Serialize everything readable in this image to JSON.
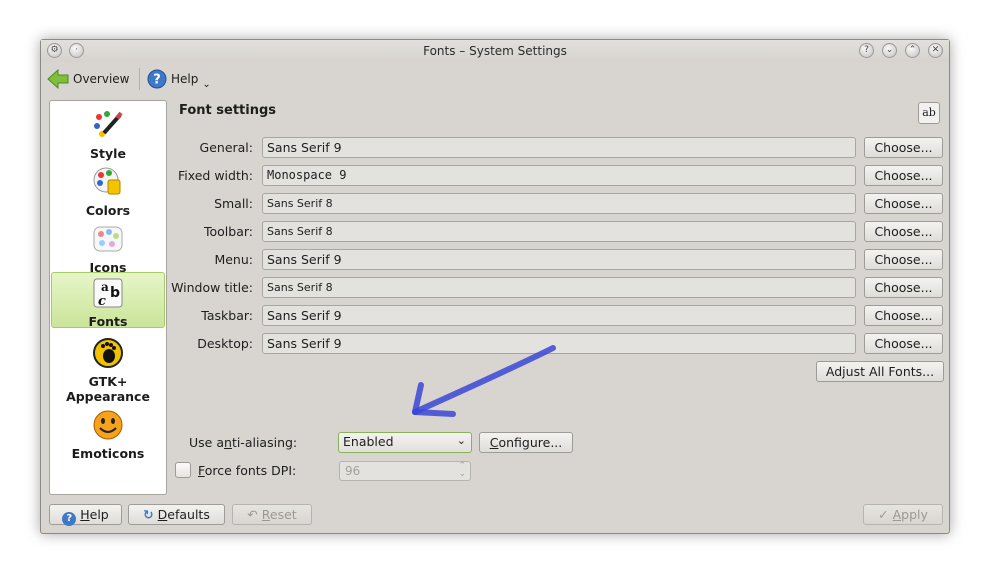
{
  "window": {
    "title": "Fonts – System Settings"
  },
  "toolbar": {
    "overview_label": "Overview",
    "help_label": "Help"
  },
  "sidebar": {
    "items": [
      {
        "label": "Style",
        "icon": "style-brush-icon"
      },
      {
        "label": "Colors",
        "icon": "colors-palette-icon"
      },
      {
        "label": "Icons",
        "icon": "icons-palette-icon"
      },
      {
        "label": "Fonts",
        "icon": "fonts-icon"
      },
      {
        "label": "GTK+\nAppearance",
        "label_line1": "GTK+",
        "label_line2": "Appearance",
        "icon": "gnome-foot-icon"
      },
      {
        "label": "Emoticons",
        "icon": "smiley-icon"
      }
    ],
    "active": "Fonts"
  },
  "main": {
    "heading": "Font settings",
    "fonts": [
      {
        "label": "General:",
        "value": "Sans Serif 9"
      },
      {
        "label": "Fixed width:",
        "value": "Monospace 9"
      },
      {
        "label": "Small:",
        "value": "Sans Serif 8"
      },
      {
        "label": "Toolbar:",
        "value": "Sans Serif 8"
      },
      {
        "label": "Menu:",
        "value": "Sans Serif 9"
      },
      {
        "label": "Window title:",
        "value": "Sans Serif 8"
      },
      {
        "label": "Taskbar:",
        "value": "Sans Serif 9"
      },
      {
        "label": "Desktop:",
        "value": "Sans Serif 9"
      }
    ],
    "choose_label": "Choose...",
    "adjust_all_label": "Adjust All Fonts...",
    "antialias": {
      "label_pre": "Use a",
      "label_u": "n",
      "label_post": "ti-aliasing:",
      "value": "Enabled"
    },
    "configure": {
      "u": "C",
      "rest": "onfigure..."
    },
    "dpi": {
      "label_u": "F",
      "label_rest": "orce fonts DPI:",
      "value": "96",
      "checked": false
    }
  },
  "buttons": {
    "help": {
      "u": "H",
      "rest": "elp"
    },
    "defaults": {
      "u": "D",
      "rest": "efaults"
    },
    "reset": {
      "u": "R",
      "rest": "eset"
    },
    "apply": {
      "u": "A",
      "rest": "pply"
    }
  },
  "colors": {
    "accent_green": "#a6cc6a",
    "annotation_arrow": "#3b46d6"
  }
}
